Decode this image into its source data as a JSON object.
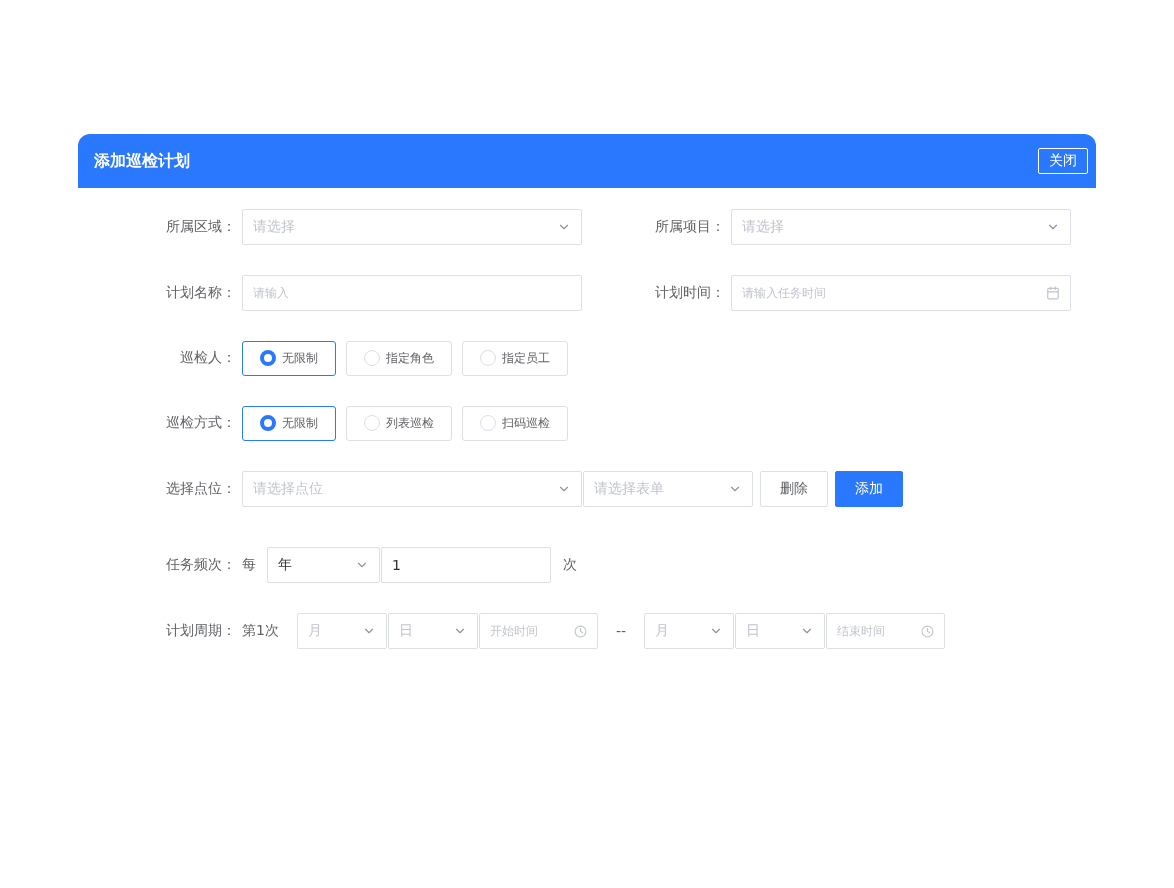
{
  "dialog": {
    "title": "添加巡检计划",
    "close_button": "关闭"
  },
  "rows": [
    {
      "kind": "pair",
      "items": [
        {
          "label": "所属区域：",
          "kind": "select",
          "placeholder": "请选择"
        },
        {
          "label": "所属项目：",
          "kind": "select",
          "placeholder": "请选择"
        }
      ]
    },
    {
      "kind": "pair",
      "items": [
        {
          "label": "计划名称：",
          "kind": "input",
          "placeholder": "请输入"
        },
        {
          "label": "计划时间：",
          "kind": "date",
          "placeholder": "请输入任务时间"
        }
      ]
    },
    {
      "kind": "radio",
      "label": "巡检人：",
      "options": [
        {
          "label": "无限制",
          "selected": true
        },
        {
          "label": "指定角色",
          "selected": false
        },
        {
          "label": "指定员工",
          "selected": false
        }
      ]
    },
    {
      "kind": "radio",
      "label": "巡检方式：",
      "options": [
        {
          "label": "无限制",
          "selected": true
        },
        {
          "label": "列表巡检",
          "selected": false
        },
        {
          "label": "扫码巡检",
          "selected": false
        }
      ]
    },
    {
      "kind": "points",
      "label": "选择点位：",
      "point_placeholder": "请选择点位",
      "form_placeholder": "请选择表单",
      "delete_button": "删除",
      "add_button": "添加"
    },
    {
      "kind": "frequency",
      "label": "任务频次：",
      "prefix": "每",
      "unit": "年",
      "count": "1",
      "suffix": "次"
    },
    {
      "kind": "period",
      "label": "计划周期：",
      "index": "第1次",
      "start": {
        "month": "月",
        "day": "日",
        "time": "开始时间"
      },
      "separator": "--",
      "end": {
        "month": "月",
        "day": "日",
        "time": "结束时间"
      }
    }
  ]
}
